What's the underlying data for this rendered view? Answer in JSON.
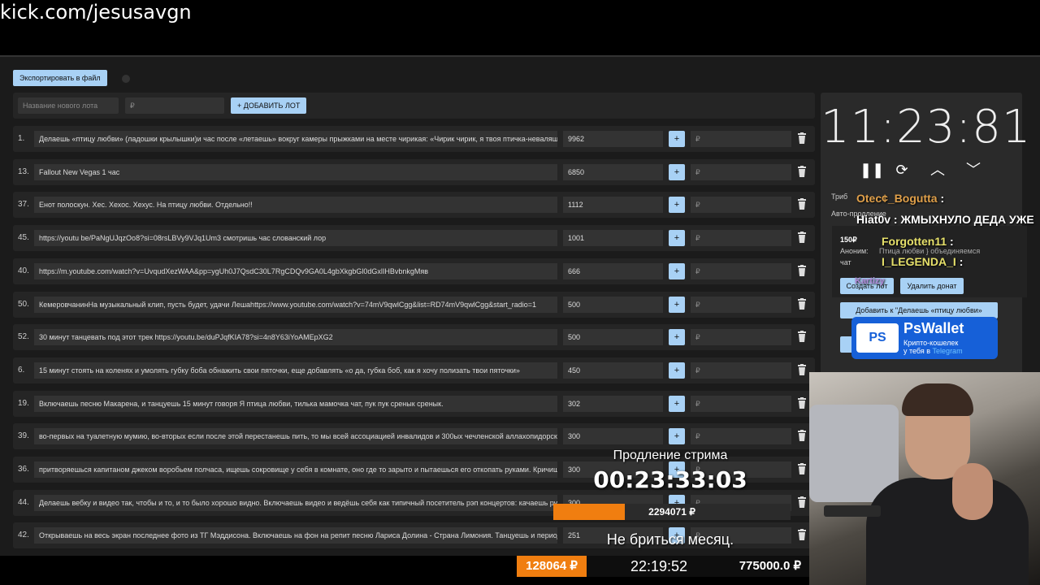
{
  "url": "kick.com/jesusavgn",
  "toolbar": {
    "export_label": "Экспортировать в файл"
  },
  "new_lot": {
    "name_placeholder": "Название нового лота",
    "amount_placeholder": "₽",
    "add_label": "+ ДОБАВИТЬ ЛОТ"
  },
  "lots": [
    {
      "num": "1.",
      "title": "Делаешь «птицу любви» (ладошки крылышки)и час после «летаешь» вокруг камеры прыжками на месте чирикая: «Чирик чирик, я твоя птичка-неваляшка",
      "amount": "9962"
    },
    {
      "num": "13.",
      "title": "Fallout New Vegas 1 час",
      "amount": "6850"
    },
    {
      "num": "37.",
      "title": "Енот полоскун. Хес. Хехос. Хехус. На птицу любви. Отдельно!!",
      "amount": "1112"
    },
    {
      "num": "45.",
      "title": "https://youtu be/PaNgUJqzOo8?si=08rsLBVy9VJq1Um3 смотришь час слованский лор",
      "amount": "1001"
    },
    {
      "num": "40.",
      "title": "https://m.youtube.com/watch?v=UvqudXezWAA&pp=ygUh0J7QsdC30L7RgCDQv9GA0L4gbXkgbGl0dGxlIHBvbnkgMяв",
      "amount": "666"
    },
    {
      "num": "50.",
      "title": "КемеровчанинНа музыкальный клип, пусть будет, удачи Лешаhttps://www.youtube.com/watch?v=74mV9qwlCgg&list=RD74mV9qwlCgg&start_radio=1",
      "amount": "500"
    },
    {
      "num": "52.",
      "title": "30 минут танцевать под этот трек https://youtu.be/duPJqfKIA78?si=4n8Y63iYoAMEpXG2",
      "amount": "500"
    },
    {
      "num": "6.",
      "title": "15 минут стоять на коленях и умолять губку боба обнажить свои пяточки, еще добавлять «о да, губка боб, как я хочу полизать твои пяточки»",
      "amount": "450"
    },
    {
      "num": "19.",
      "title": "Включаешь песню Макарена, и танцуешь 15 минут говоря Я птица любви, тилька мамочка чат, пук пук сренык сренык.",
      "amount": "302"
    },
    {
      "num": "39.",
      "title": "во-первых на туалетную мумию, во-вторых если после этой перестанешь пить, то мы всей ассоциацией инвалидов и 300ых чечленской аллахопидорской",
      "amount": "300"
    },
    {
      "num": "36.",
      "title": "притворяешься капитаном джеком воробьем полчаса, ищешь сокровище у себя в комнате, оно где то зарыто и пытаешься его откопать руками. Кричишь",
      "amount": "300"
    },
    {
      "num": "44.",
      "title": "Делаешь вебку и видео так, чтобы и то, и то было хорошо видно. Включаешь видео и ведёшь себя как типичный посетитель рэп концертов: качаешь руками",
      "amount": "300"
    },
    {
      "num": "42.",
      "title": "Открываешь на весь экран последнее фото из ТГ Мэддисона. Включаешь на фон на репит песню Лариса Долина - Страна Лимония. Танцуешь и периодически",
      "amount": "251"
    }
  ],
  "row_plus": "+",
  "row_rub": "₽",
  "timer": {
    "value": "11:23:81"
  },
  "controls": {
    "pause": "❚❚",
    "refresh": "⟳",
    "up": "︿",
    "down": "﹀"
  },
  "settings": {
    "tribute_label": "Триб",
    "auto_label": "Авто-продление"
  },
  "chat": [
    {
      "user": "Otec¢_Bogutta",
      "sep": ":",
      "text": "",
      "color": "#e0a04a"
    },
    {
      "user": "Hiat0v",
      "sep": ":",
      "text": "ЖМЫХНУЛО ДЕДА УЖЕ",
      "color": "#ffffff"
    },
    {
      "user": "Forgotten11",
      "sep": ":",
      "text": "",
      "color": "#e6e06a"
    },
    {
      "user": "I_LEGENDA_I",
      "sep": ":",
      "text": "",
      "color": "#e6e06a"
    },
    {
      "user": "Kartizy",
      "sep": "",
      "text": "",
      "color": "#b08ad8"
    }
  ],
  "donation": {
    "amount": "150₽",
    "anon": "Аноним:",
    "msg": "Птица любви } объединяемся",
    "chat": "чат"
  },
  "buttons": {
    "create": "Создать лот",
    "delete": "Удалить донат",
    "add_to": "Добавить к \"Делаешь «птицу любви»"
  },
  "pswallet": {
    "logo": "PS",
    "title": "PsWallet",
    "line1": "Крипто-кошелек",
    "line2_pre": "у тебя в ",
    "line2_link": "Telegram"
  },
  "extension": {
    "title": "Продление стрима",
    "time": "00:23:33:03"
  },
  "progress": {
    "text": "2294071 ₽",
    "fraction": 0.3
  },
  "goal": {
    "text": "Не бриться месяц."
  },
  "bottom": {
    "left": "128064 ₽",
    "mid": "22:19:52",
    "right": "775000.0 ₽"
  },
  "colors": {
    "accent": "#a8d1f5",
    "orange": "#f07e10",
    "panel": "#252525"
  }
}
